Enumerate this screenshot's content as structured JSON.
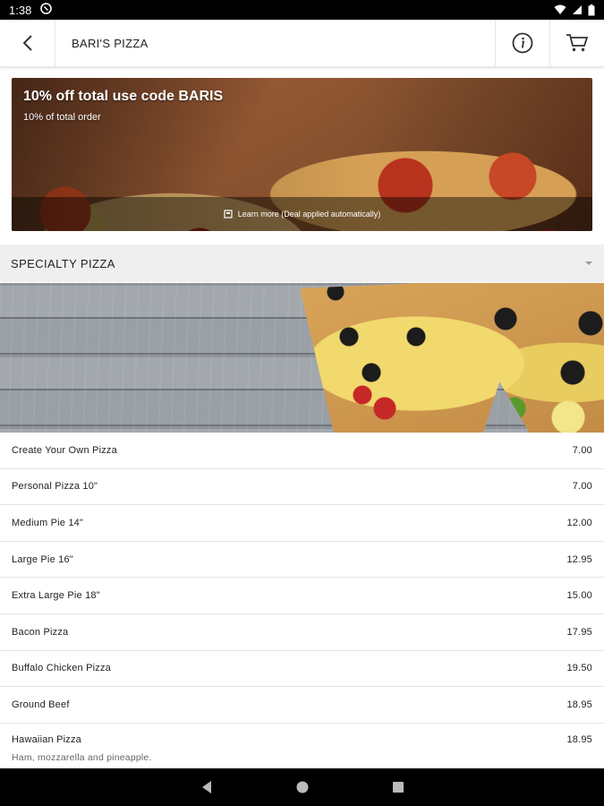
{
  "status_bar": {
    "time": "1:38"
  },
  "app_bar": {
    "title": "BARI'S PIZZA"
  },
  "promo": {
    "headline": "10% off total use code BARIS",
    "subtext": "10% of total order",
    "footer": "Learn more (Deal applied automatically)"
  },
  "section": {
    "title": "SPECIALTY PIZZA"
  },
  "menu_items": [
    {
      "name": "Create Your Own Pizza",
      "price": "7.00"
    },
    {
      "name": "Personal Pizza 10\"",
      "price": "7.00"
    },
    {
      "name": "Medium Pie 14\"",
      "price": "12.00"
    },
    {
      "name": "Large Pie 16\"",
      "price": "12.95"
    },
    {
      "name": "Extra Large Pie 18\"",
      "price": "15.00"
    },
    {
      "name": "Bacon Pizza",
      "price": "17.95"
    },
    {
      "name": "Buffalo Chicken Pizza",
      "price": "19.50"
    },
    {
      "name": "Ground Beef",
      "price": "18.95"
    },
    {
      "name": "Hawaiian Pizza",
      "price": "18.95",
      "description": "Ham, mozzarella and pineapple."
    }
  ],
  "icons": {
    "back": "arrow-back-icon",
    "info": "info-icon",
    "cart": "cart-icon"
  },
  "colors": {
    "status_bar": "#000000",
    "section_bg": "#efefef",
    "divider": "#e3e3e3"
  }
}
